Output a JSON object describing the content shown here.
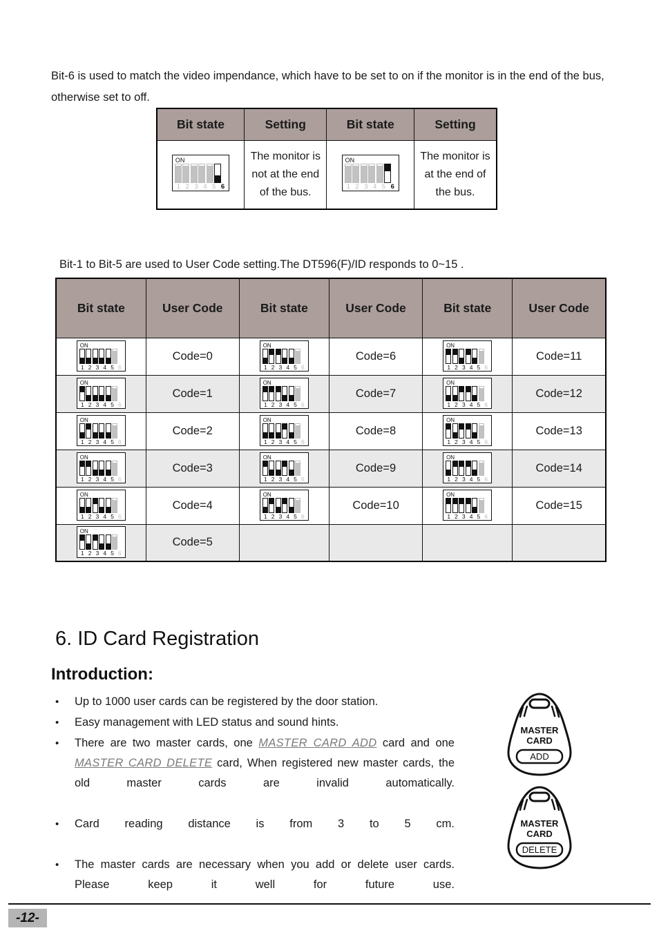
{
  "intro": {
    "bit6_note": "Bit-6 is used to match the video impendance, which have to be set to on if the monitor is in the end of the bus, otherwise set to off.",
    "bit15_note": "Bit-1 to Bit-5 are used to User Code setting.The DT596(F)/ID responds to 0~15 ."
  },
  "end_bus_table": {
    "headers": [
      "Bit state",
      "Setting",
      "Bit state",
      "Setting"
    ],
    "rows": [
      {
        "left_switch": {
          "on_label": "ON",
          "numbers": [
            "1",
            "2",
            "3",
            "4",
            "5",
            "6"
          ],
          "states": [
            "grey",
            "grey",
            "grey",
            "grey",
            "grey",
            "off"
          ],
          "bold_index": 5
        },
        "left_setting": "The monitor is not at the end of the bus.",
        "right_switch": {
          "on_label": "ON",
          "numbers": [
            "1",
            "2",
            "3",
            "4",
            "5",
            "6"
          ],
          "states": [
            "grey",
            "grey",
            "grey",
            "grey",
            "grey",
            "on"
          ],
          "bold_index": 5
        },
        "right_setting": "The monitor is at the end of the bus."
      }
    ]
  },
  "codes_table": {
    "headers": [
      "Bit state",
      "User Code",
      "Bit state",
      "User Code",
      "Bit state",
      "User Code"
    ],
    "on_label": "ON",
    "numbers": [
      "1",
      "2",
      "3",
      "4",
      "5",
      "6"
    ],
    "rows": [
      {
        "c1": {
          "code": "Code=0",
          "states": [
            "off",
            "off",
            "off",
            "off",
            "off",
            "grey"
          ]
        },
        "c2": {
          "code": "Code=6",
          "states": [
            "off",
            "on",
            "on",
            "off",
            "off",
            "grey"
          ]
        },
        "c3": {
          "code": "Code=11",
          "states": [
            "on",
            "on",
            "off",
            "on",
            "off",
            "grey"
          ]
        }
      },
      {
        "c1": {
          "code": "Code=1",
          "states": [
            "on",
            "off",
            "off",
            "off",
            "off",
            "grey"
          ]
        },
        "c2": {
          "code": "Code=7",
          "states": [
            "on",
            "on",
            "on",
            "off",
            "off",
            "grey"
          ]
        },
        "c3": {
          "code": "Code=12",
          "states": [
            "off",
            "off",
            "on",
            "on",
            "off",
            "grey"
          ]
        }
      },
      {
        "c1": {
          "code": "Code=2",
          "states": [
            "off",
            "on",
            "off",
            "off",
            "off",
            "grey"
          ]
        },
        "c2": {
          "code": "Code=8",
          "states": [
            "off",
            "off",
            "off",
            "on",
            "off",
            "grey"
          ]
        },
        "c3": {
          "code": "Code=13",
          "states": [
            "on",
            "off",
            "on",
            "on",
            "off",
            "grey"
          ]
        }
      },
      {
        "c1": {
          "code": "Code=3",
          "states": [
            "on",
            "on",
            "off",
            "off",
            "off",
            "grey"
          ]
        },
        "c2": {
          "code": "Code=9",
          "states": [
            "on",
            "off",
            "off",
            "on",
            "off",
            "grey"
          ]
        },
        "c3": {
          "code": "Code=14",
          "states": [
            "off",
            "on",
            "on",
            "on",
            "off",
            "grey"
          ]
        }
      },
      {
        "c1": {
          "code": "Code=4",
          "states": [
            "off",
            "off",
            "on",
            "off",
            "off",
            "grey"
          ]
        },
        "c2": {
          "code": "Code=10",
          "states": [
            "off",
            "on",
            "off",
            "on",
            "off",
            "grey"
          ]
        },
        "c3": {
          "code": "Code=15",
          "states": [
            "on",
            "on",
            "on",
            "on",
            "off",
            "grey"
          ]
        }
      },
      {
        "c1": {
          "code": "Code=5",
          "states": [
            "on",
            "off",
            "on",
            "off",
            "off",
            "grey"
          ]
        },
        "c2": {
          "code": "",
          "states": null
        },
        "c3": {
          "code": "",
          "states": null
        }
      }
    ]
  },
  "section": {
    "title": "6. ID Card Registration",
    "subtitle": "Introduction:"
  },
  "bullets": [
    {
      "marker": "•",
      "parts": [
        {
          "text": "Up to 1000 user cards can be registered by the door station."
        }
      ]
    },
    {
      "marker": "•",
      "parts": [
        {
          "text": "Easy management with LED status and sound hints."
        }
      ]
    },
    {
      "marker": "•",
      "parts": [
        {
          "text": "There are two master cards, one "
        },
        {
          "text": "MASTER CARD ADD",
          "style": "master-card"
        },
        {
          "text": " card and one "
        },
        {
          "text": "MASTER CARD DELETE",
          "style": "master-card"
        },
        {
          "text": " card, When registered new master cards, the old master cards are invalid automatically."
        }
      ]
    },
    {
      "marker": "•",
      "parts": [
        {
          "text": "Card reading distance is from 3 to 5 cm."
        }
      ]
    },
    {
      "marker": "•",
      "parts": [
        {
          "text": "The master cards are necessary when you add or delete user cards. Please keep it well for future use."
        }
      ]
    }
  ],
  "fobs": [
    {
      "line1": "MASTER",
      "line2": "CARD",
      "action": "ADD"
    },
    {
      "line1": "MASTER",
      "line2": "CARD",
      "action": "DELETE"
    }
  ],
  "footer": {
    "page_number": "-12-"
  },
  "colors": {
    "table_header_bg": "#ab9e9b",
    "row_alt_bg": "#e9e9e9",
    "page_number_bg": "#b5b5b5",
    "master_card_text": "#7a7a7a",
    "ink": "#111111"
  }
}
